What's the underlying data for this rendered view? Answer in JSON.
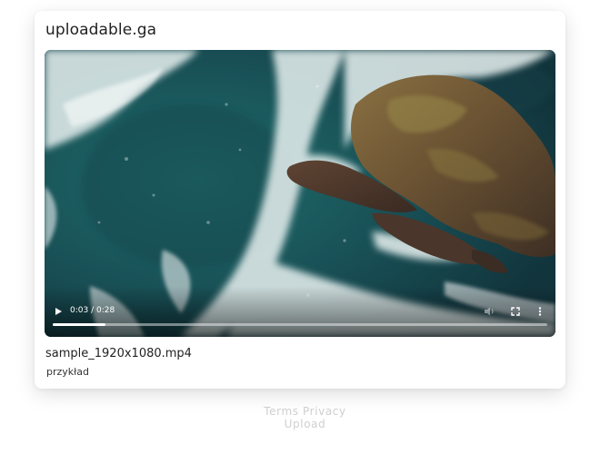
{
  "header": {
    "site_title": "uploadable.ga"
  },
  "video": {
    "current_time": "0:03",
    "duration": "0:28",
    "time_display": "0:03 / 0:28",
    "progress_fraction": 0.107,
    "icons": {
      "play": "play-icon",
      "volume": "volume-icon",
      "fullscreen": "fullscreen-icon",
      "more": "more-vertical-icon"
    }
  },
  "file": {
    "name": "sample_1920x1080.mp4",
    "description": "przykład"
  },
  "footer": {
    "links": [
      "Terms",
      "Privacy",
      "Upload"
    ]
  },
  "colors": {
    "page_background": "#ffffff",
    "footer_text": "#cfcfcf",
    "title_text": "#222222"
  }
}
